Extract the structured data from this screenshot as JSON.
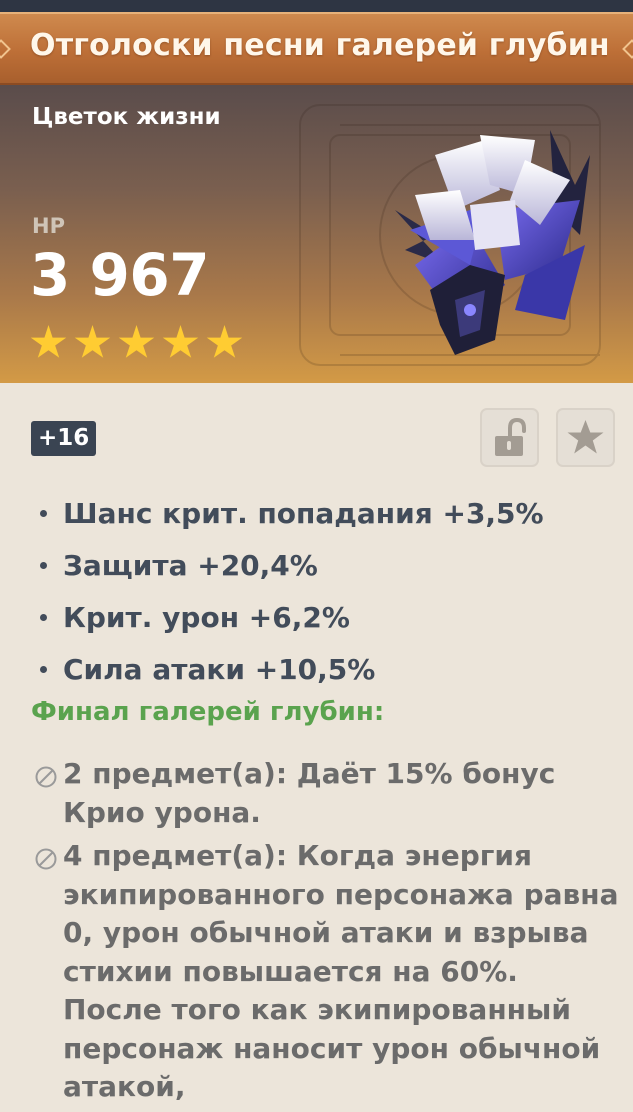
{
  "artifact": {
    "name": "Отголоски песни галерей глубин",
    "slot": "Цветок жизни",
    "main_stat": {
      "name": "HP",
      "value": "3 967"
    },
    "rarity": 5,
    "level": "+16",
    "substats": [
      {
        "text": "Шанс крит. попадания +3,5%"
      },
      {
        "text": "Защита +20,4%"
      },
      {
        "text": "Крит. урон +6,2%"
      },
      {
        "text": "Сила атаки +10,5%"
      }
    ],
    "set": {
      "name": "Финал галерей глубин:",
      "effects": [
        {
          "text": "2 предмет(а): Даёт 15% бонус Крио урона."
        },
        {
          "text": "4 предмет(а): Когда энергия экипированного персонажа равна 0, урон обычной атаки и взрыва стихии повышается на 60%. После того как экипированный персонаж наносит урон обычной атакой,"
        }
      ]
    }
  },
  "icons": {
    "lock": "unlocked-padlock-icon",
    "favorite": "star-icon",
    "set_bonus": "inactive-circle-slash-icon"
  },
  "colors": {
    "title_bar": "#bd6f37",
    "star": "#ffcc32",
    "set_name": "#5aa34e",
    "substat_text": "#424c5a",
    "effect_text": "#6b6b6b"
  }
}
